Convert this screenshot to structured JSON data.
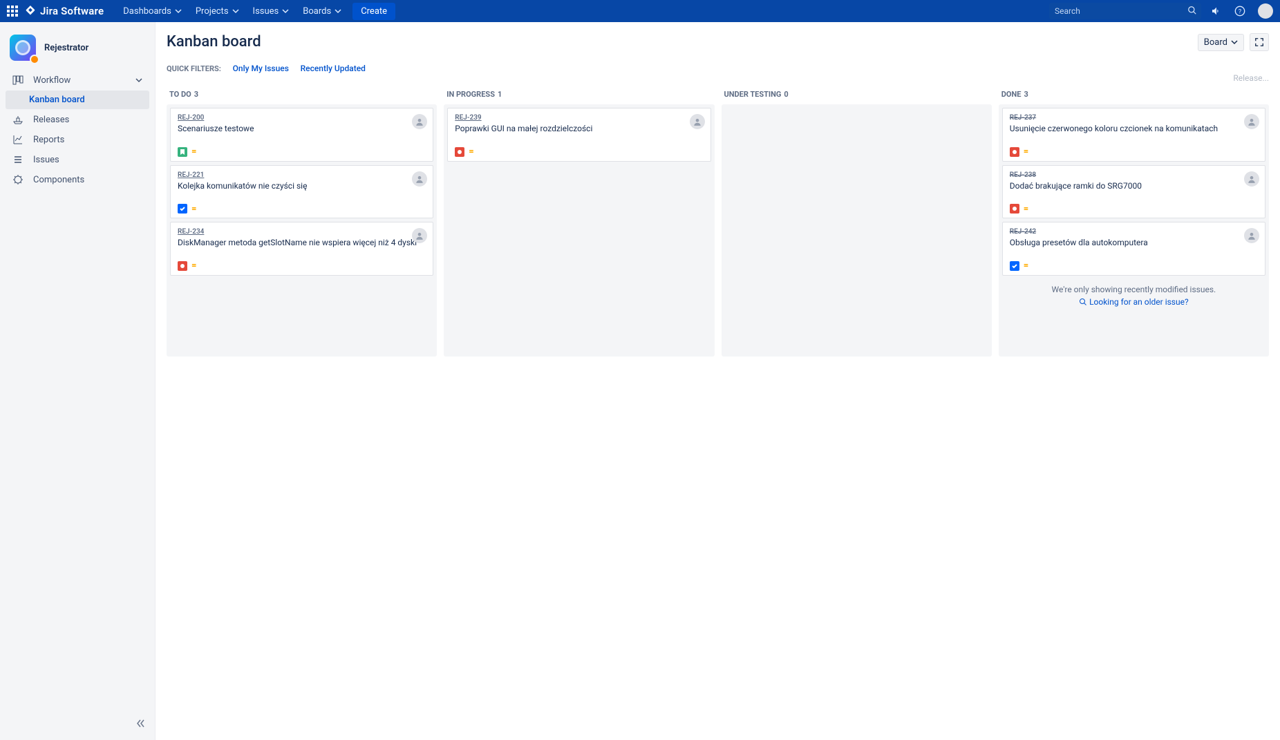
{
  "nav": {
    "logo": "Jira Software",
    "dashboards": "Dashboards",
    "projects": "Projects",
    "issues": "Issues",
    "boards": "Boards",
    "create": "Create",
    "search_placeholder": "Search"
  },
  "sidebar": {
    "project_name": "Rejestrator",
    "workflow": "Workflow",
    "kanban": "Kanban board",
    "releases": "Releases",
    "reports": "Reports",
    "issues": "Issues",
    "components": "Components"
  },
  "header": {
    "title": "Kanban board",
    "board_button": "Board",
    "quick_filters_label": "QUICK FILTERS:",
    "filter_my": "Only My Issues",
    "filter_recent": "Recently Updated",
    "release": "Release..."
  },
  "columns": {
    "todo": {
      "title": "TO DO",
      "count": 3
    },
    "inprogress": {
      "title": "IN PROGRESS",
      "count": 1
    },
    "undertesting": {
      "title": "UNDER TESTING",
      "count": 0
    },
    "done": {
      "title": "DONE",
      "count": 3
    }
  },
  "cards": {
    "c0": {
      "key": "REJ-200",
      "title": "Scenariusze testowe",
      "type": "story",
      "prio": "medium"
    },
    "c1": {
      "key": "REJ-221",
      "title": "Kolejka komunikatów nie czyści się",
      "type": "task",
      "prio": "medium"
    },
    "c2": {
      "key": "REJ-234",
      "title": "DiskManager metoda getSlotName nie wspiera więcej niż 4 dyski",
      "type": "bug",
      "prio": "medium"
    },
    "c3": {
      "key": "REJ-239",
      "title": "Poprawki GUI na małej rozdzielczości",
      "type": "bug",
      "prio": "medium"
    },
    "c4": {
      "key": "REJ-237",
      "title": "Usunięcie czerwonego koloru czcionek na komunikatach",
      "type": "bug",
      "prio": "medium"
    },
    "c5": {
      "key": "REJ-238",
      "title": "Dodać brakujące ramki do SRG7000",
      "type": "bug",
      "prio": "medium"
    },
    "c6": {
      "key": "REJ-242",
      "title": "Obsługa presetów dla autokomputera",
      "type": "task",
      "prio": "medium"
    }
  },
  "older": {
    "msg": "We're only showing recently modified issues.",
    "link": "Looking for an older issue?"
  }
}
